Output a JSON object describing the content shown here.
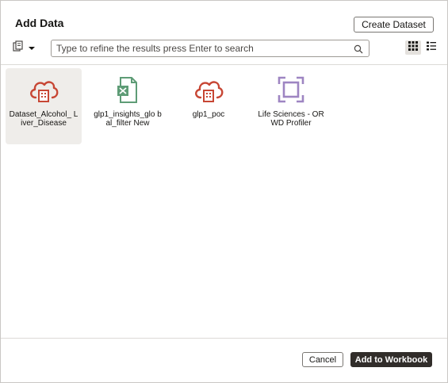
{
  "dialog": {
    "title": "Add Data",
    "create_dataset_label": "Create Dataset"
  },
  "toolbar": {
    "source_picker_icon": "data-source-icon",
    "search": {
      "placeholder": "Type to refine the results press Enter to search",
      "value": ""
    },
    "view_grid_icon": "grid-view-icon",
    "view_list_icon": "list-view-icon",
    "selected_view": "grid"
  },
  "items": [
    {
      "label": "Dataset_Alcohol_ Liver_Disease",
      "icon": "cloud-database-icon",
      "selected": true
    },
    {
      "label": "glp1_insights_glo bal_filter New",
      "icon": "excel-file-icon",
      "selected": false
    },
    {
      "label": "glp1_poc",
      "icon": "cloud-database-icon",
      "selected": false
    },
    {
      "label": "Life Sciences - ORWD Profiler",
      "icon": "subject-area-icon",
      "selected": false
    }
  ],
  "footer": {
    "cancel_label": "Cancel",
    "add_label": "Add to Workbook"
  },
  "colors": {
    "cloud_icon": "#c74634",
    "excel_icon": "#5e9c76",
    "subject_area_icon": "#9e85c2",
    "primary_button": "#312d2a"
  }
}
